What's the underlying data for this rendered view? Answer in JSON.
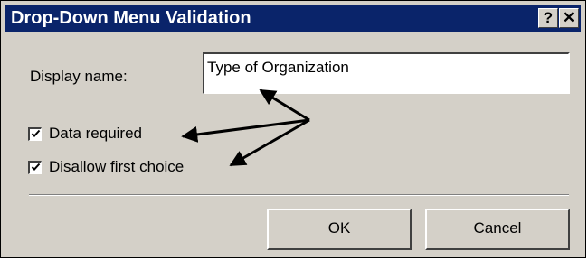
{
  "window": {
    "title": "Drop-Down Menu Validation",
    "help_label": "?",
    "close_label": "✕"
  },
  "form": {
    "display_name_label": "Display name:",
    "display_name_value": "Type of Organization",
    "data_required_label": "Data required",
    "data_required_checked": true,
    "disallow_first_label": "Disallow first choice",
    "disallow_first_checked": true
  },
  "buttons": {
    "ok_label": "OK",
    "cancel_label": "Cancel"
  },
  "colors": {
    "titlebar": "#0a246a",
    "dialog_face": "#d4d0c8"
  },
  "icons": [
    "help-icon",
    "close-icon",
    "checkmark-icon"
  ]
}
